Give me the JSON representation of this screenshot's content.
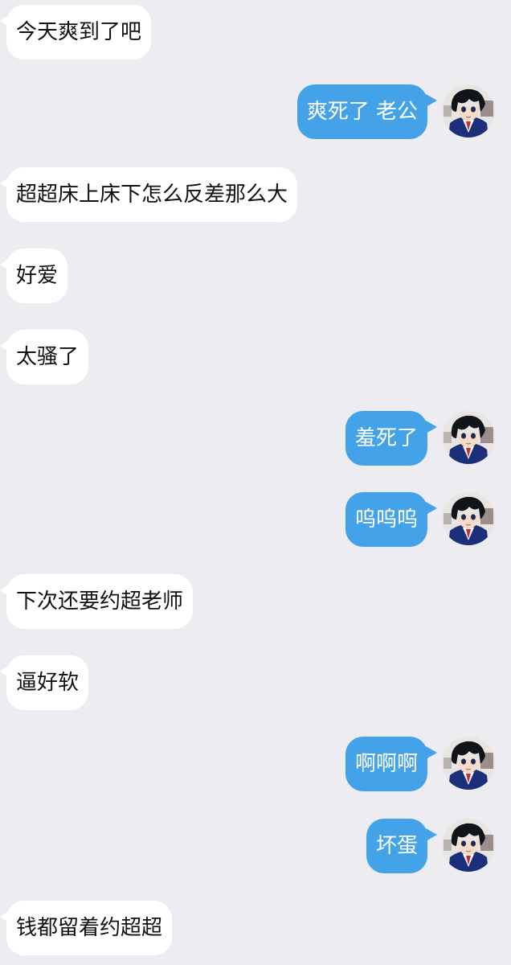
{
  "colors": {
    "background": "#ececf1",
    "incoming_bubble": "#ffffff",
    "outgoing_bubble": "#44a3e8",
    "incoming_text": "#111111",
    "outgoing_text": "#ffffff"
  },
  "messages": [
    {
      "side": "in",
      "text": "今天爽到了吧"
    },
    {
      "side": "out",
      "text": "爽死了 老公",
      "avatar": "anime-character-avatar-icon"
    },
    {
      "side": "in",
      "text": "超超床上床下怎么反差那么大"
    },
    {
      "side": "in",
      "text": "好爱"
    },
    {
      "side": "in",
      "text": "太骚了"
    },
    {
      "side": "out",
      "text": "羞死了",
      "avatar": "anime-character-avatar-icon"
    },
    {
      "side": "out",
      "text": "呜呜呜",
      "avatar": "anime-character-avatar-icon"
    },
    {
      "side": "in",
      "text": "下次还要约超老师"
    },
    {
      "side": "in",
      "text": "逼好软"
    },
    {
      "side": "out",
      "text": "啊啊啊",
      "avatar": "anime-character-avatar-icon"
    },
    {
      "side": "out",
      "text": "坏蛋",
      "avatar": "anime-character-avatar-icon"
    },
    {
      "side": "in",
      "text": "钱都留着约超超"
    }
  ]
}
